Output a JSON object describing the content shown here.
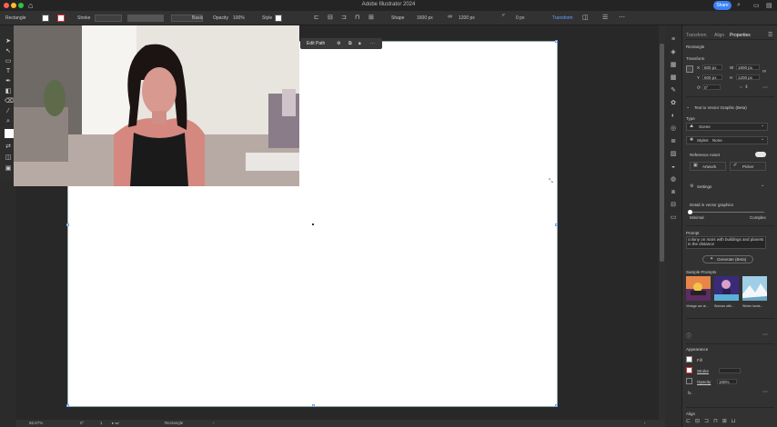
{
  "window": {
    "title": "Adobe Illustrator 2024",
    "share_label": "Share"
  },
  "controlbar": {
    "selection": "Rectangle",
    "stroke_label": "Stroke",
    "brush_label": "Basic",
    "opacity_label": "Opacity",
    "opacity_value": "100%",
    "style_label": "Style",
    "shape_label": "Shape",
    "width_value": "1600 px",
    "height_value": "1200 px",
    "corner_value": "0 px",
    "transform_label": "Transform"
  },
  "context_bar": {
    "edit_path_label": "Edit Path"
  },
  "panel": {
    "tabs": [
      "Transform",
      "Align",
      "Properties"
    ],
    "active_tab": "Properties",
    "object_type": "Rectangle",
    "transform_title": "Transform",
    "x_label": "X",
    "x_value": "800 px",
    "y_label": "Y",
    "y_value": "600 px",
    "w_label": "W",
    "w_value": "1600 px",
    "h_label": "H",
    "h_value": "1200 px",
    "angle_value": "0°",
    "text_to_vector_title": "Text to Vector Graphic (Beta)",
    "type_label": "Type",
    "type_value": "Scene",
    "styles_label": "Styles:",
    "styles_value": "None",
    "reference_label": "Reference Asset",
    "artwork_label": "Artwork",
    "picker_label": "Picker",
    "settings_label": "Settings",
    "detail_label": "Detail in vector graphics",
    "detail_min": "Minimal",
    "detail_max": "Complex",
    "prompt_label": "Prompt",
    "prompt_text": "colony on mars with buildings and planets in the distance",
    "generate_label": "Generate (Beta)",
    "sample_prompts_label": "Sample Prompts",
    "samples": [
      "Vintage car at...",
      "Woman with...",
      "Winter lands..."
    ],
    "appearance_title": "Appearance",
    "fill_label": "Fill",
    "stroke_label": "Stroke",
    "opacity_label": "Opacity",
    "opacity_value": "100%",
    "fx_label": "fx.",
    "align_label": "Align"
  },
  "status": {
    "zoom": "66.67%",
    "rotation": "0°",
    "artboard_num": "1",
    "tool_name": "Rectangle"
  },
  "colors": {
    "accent": "#3b82f6",
    "canvas": "#282828",
    "panel": "#323232"
  }
}
